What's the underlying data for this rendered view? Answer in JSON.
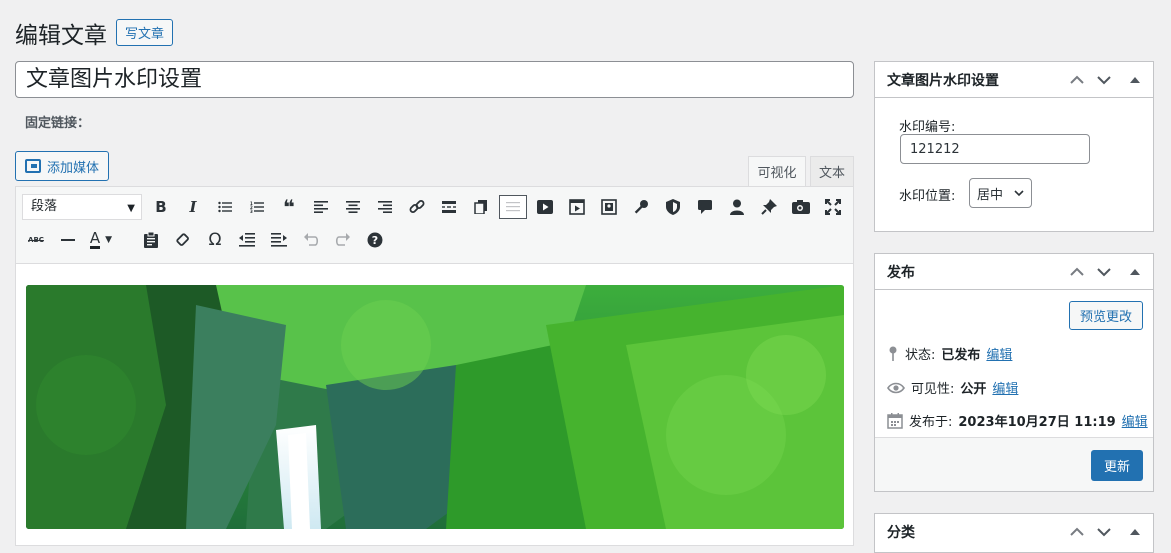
{
  "header": {
    "title": "编辑文章",
    "add_new": "写文章"
  },
  "post": {
    "title": "文章图片水印设置",
    "permalink_label": "固定链接："
  },
  "editor": {
    "add_media": "添加媒体",
    "tabs": {
      "visual": "可视化",
      "text": "文本"
    },
    "format_select": "段落",
    "toolbar_row1": [
      "bold-icon",
      "italic-icon",
      "bullet-list-icon",
      "numbered-list-icon",
      "blockquote-icon",
      "align-left-icon",
      "align-center-icon",
      "align-right-icon",
      "link-icon",
      "read-more-icon",
      "copy-icon",
      "toolbar-toggle-icon",
      "video-icon",
      "media-player-icon",
      "image-icon",
      "key-icon",
      "shield-icon",
      "comment-icon",
      "user-icon",
      "pin-icon",
      "camera-icon",
      "fullscreen-icon"
    ],
    "toolbar_row2": [
      "strikethrough-icon",
      "horizontal-line-icon",
      "text-color-icon",
      "paste-text-icon",
      "clear-format-icon",
      "special-char-icon",
      "outdent-icon",
      "indent-icon",
      "undo-icon",
      "redo-icon",
      "help-icon"
    ],
    "strike_label": "ABC",
    "omega": "Ω",
    "color_letter": "A"
  },
  "watermark_box": {
    "title": "文章图片水印设置",
    "number_label": "水印编号:",
    "number_value": "121212",
    "position_label": "水印位置:",
    "position_value": "居中"
  },
  "publish_box": {
    "title": "发布",
    "preview": "预览更改",
    "status_label": "状态:",
    "status_value": "已发布",
    "visibility_label": "可见性:",
    "visibility_value": "公开",
    "published_label": "发布于:",
    "published_value": "2023年10月27日 11:19",
    "edit": "编辑",
    "update": "更新"
  },
  "category_box": {
    "title": "分类"
  },
  "colors": {
    "accent": "#2271b1",
    "background": "#f0f0f1"
  }
}
